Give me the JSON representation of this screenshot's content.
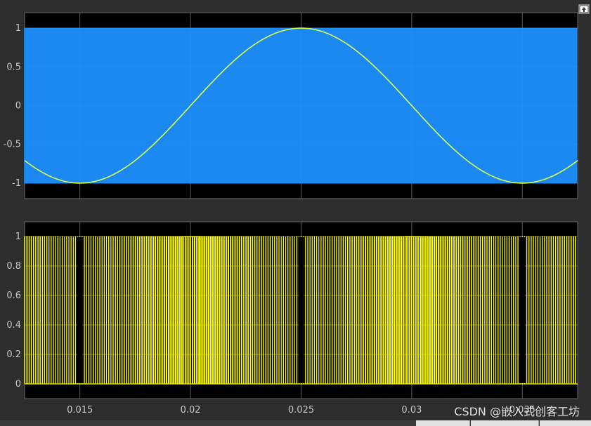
{
  "chart_data": [
    {
      "type": "line",
      "panel": "top",
      "title": "",
      "xlabel": "",
      "ylabel": "",
      "xlim": [
        0.0125,
        0.0375
      ],
      "ylim": [
        -1.2,
        1.2
      ],
      "yticks": [
        1,
        0.5,
        0,
        -0.5,
        -1
      ],
      "ytick_labels": [
        "1",
        "0.5",
        "0",
        "-0.5",
        "-1"
      ],
      "grid": true,
      "background": "#000000",
      "series": [
        {
          "color": "#1e90ff",
          "description_kind": "carrier",
          "amplitude": 1,
          "frequency_hz": 10000
        },
        {
          "color": "#d4ff4d",
          "description_kind": "modulating",
          "amplitude": 1,
          "frequency_hz": 50,
          "peak_at": 0.025
        }
      ]
    },
    {
      "type": "line",
      "panel": "bottom",
      "title": "",
      "xlabel": "",
      "ylabel": "",
      "xlim": [
        0.0125,
        0.0375
      ],
      "ylim": [
        -0.1,
        1.1
      ],
      "yticks": [
        1,
        0.8,
        0.6,
        0.4,
        0.2,
        0
      ],
      "ytick_labels": [
        "1",
        "0.8",
        "0.6",
        "0.4",
        "0.2",
        "0"
      ],
      "xticks": [
        0.015,
        0.02,
        0.025,
        0.03,
        0.035
      ],
      "xtick_labels": [
        "0.015",
        "0.02",
        "0.025",
        "0.03",
        "0.035"
      ],
      "grid": true,
      "background": "#000000",
      "series": [
        {
          "color": "#ffff00",
          "description_kind": "pwm",
          "low": 0,
          "high": 1
        }
      ]
    }
  ],
  "colors": {
    "figure_bg": "#2d2d2d",
    "axes_bg": "#000000",
    "grid": "#5a5a5a",
    "tick_text": "#c8c8c8"
  },
  "icons": {
    "restore": "restore-icon"
  },
  "watermark": "CSDN @嵌入式创客工坊"
}
